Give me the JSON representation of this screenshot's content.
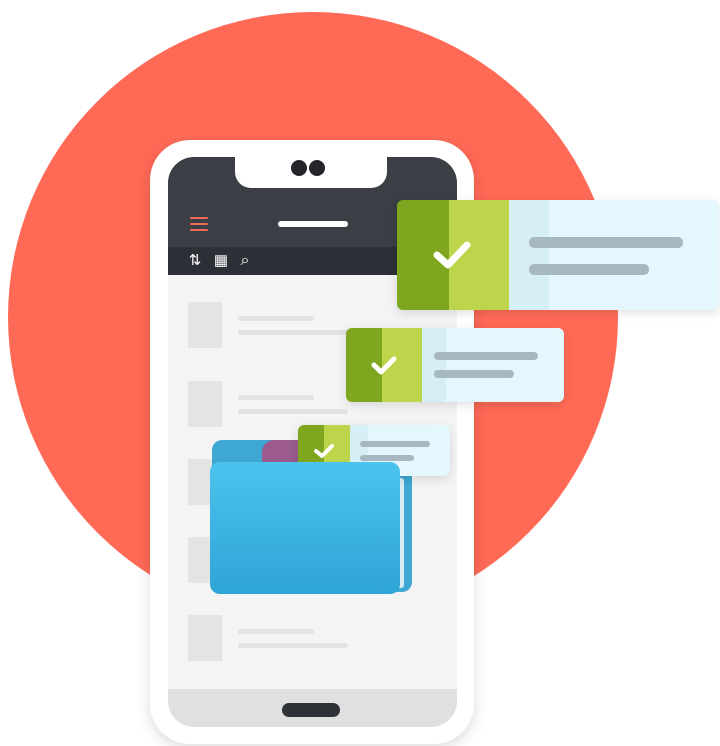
{
  "colors": {
    "circle": "#ff6a57",
    "phone_body": "#ffffff",
    "top_bar": "#3b3e45",
    "toolbar": "#2c2f35",
    "accent_menu": "#ef6b57",
    "check_green_dark": "#7ea61e",
    "check_green_light": "#bcd54a",
    "card_blue": "#e3f7fc",
    "folder_blue": "#4cc3ee",
    "folder_purple": "#9b5b8f"
  },
  "toolbar": {
    "sort_icon": "⇅",
    "grid_icon": "▦",
    "search_icon": "⌕"
  }
}
